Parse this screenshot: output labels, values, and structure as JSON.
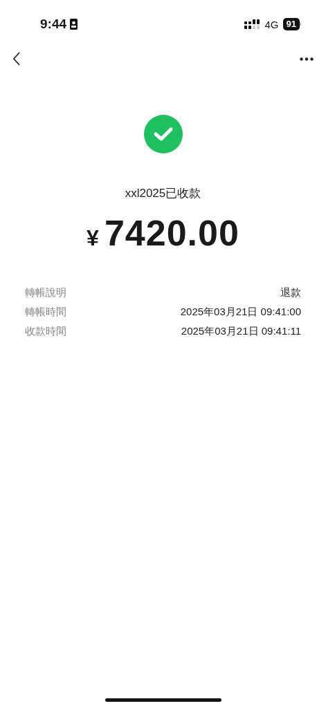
{
  "status_bar": {
    "time": "9:44",
    "network": "4G",
    "battery": "91"
  },
  "payment": {
    "status": "xxl2025已收款",
    "currency": "¥",
    "amount": "7420.00"
  },
  "details": [
    {
      "label": "轉帳說明",
      "value": "退款"
    },
    {
      "label": "轉帳時間",
      "value": "2025年03月21日 09:41:00"
    },
    {
      "label": "收款時間",
      "value": "2025年03月21日 09:41:11"
    }
  ]
}
